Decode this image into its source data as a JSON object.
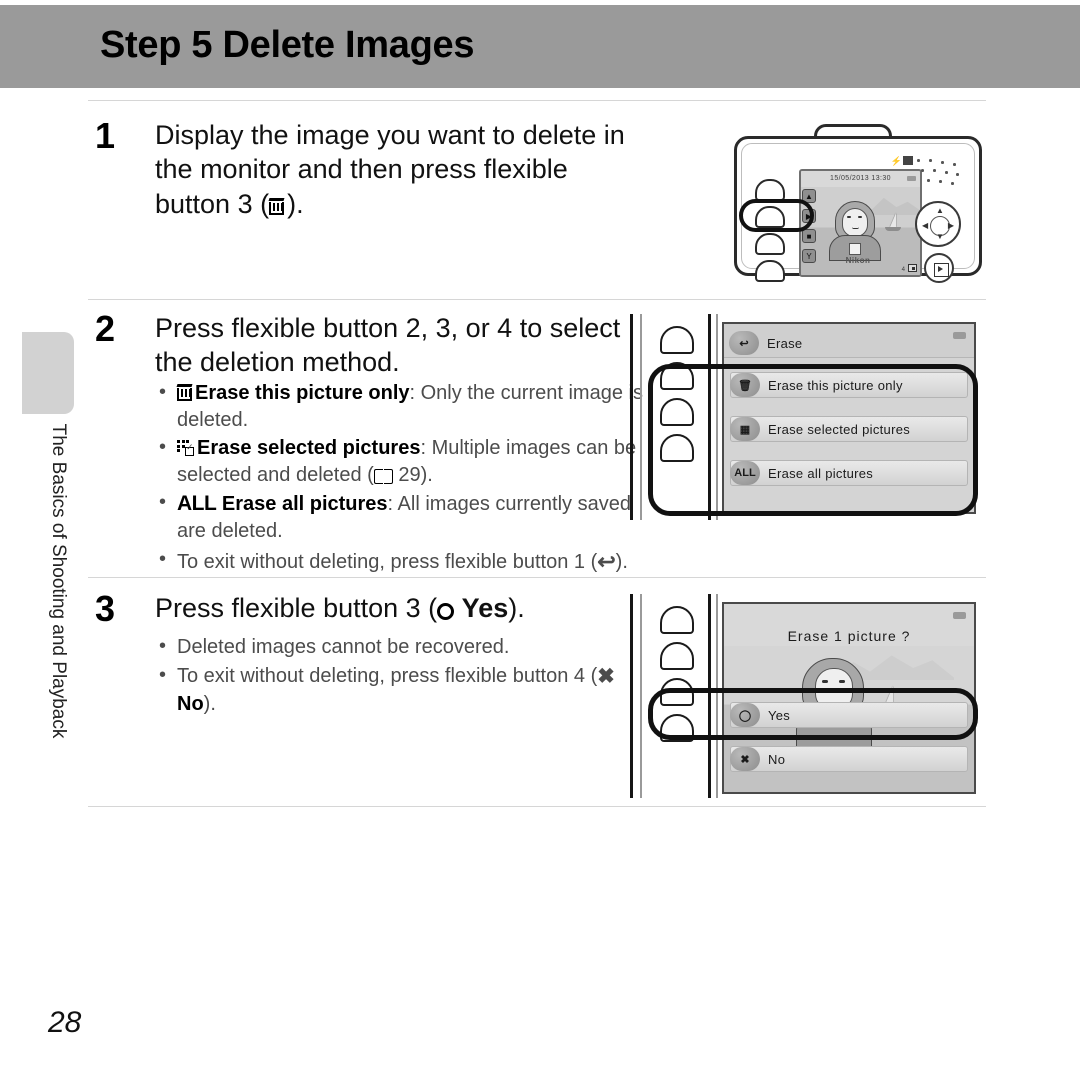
{
  "header": {
    "title": "Step 5 Delete Images"
  },
  "side_tab": {
    "label": "The Basics of Shooting and Playback"
  },
  "page_number": "28",
  "steps": [
    {
      "number": "1",
      "heading_line1": "Display the image you want to delete in the",
      "heading_line2_before": "monitor and then press flexible button 3 (",
      "heading_line2_after": ")."
    },
    {
      "number": "2",
      "heading_line1": "Press flexible button 2, 3, or 4 to select",
      "heading_line2": "the deletion method.",
      "bullets": [
        {
          "icon": "trash-icon",
          "term": "Erase this picture only",
          "text": ": Only the current image is deleted."
        },
        {
          "icon": "grid-check-icon",
          "term": "Erase selected pictures",
          "text_before": ": Multiple images can be selected and deleted (",
          "page_ref": "29",
          "text_after": ")."
        },
        {
          "icon": "all-icon",
          "icon_text": "ALL",
          "term": "Erase all pictures",
          "text": ": All images currently saved are deleted."
        },
        {
          "icon": "none",
          "text_before": "To exit without deleting, press flexible button 1 (",
          "text_after": ")."
        }
      ]
    },
    {
      "number": "3",
      "heading_before": "Press flexible button 3 (",
      "heading_yes": "Yes",
      "heading_after": ").",
      "bullets": [
        {
          "text": "Deleted images cannot be recovered."
        },
        {
          "text_before": "To exit without deleting, press flexible button 4 (",
          "no_label": "No",
          "text_after": ")."
        }
      ]
    }
  ],
  "camera_illustration": {
    "monitor_datetime": "15/05/2013  13:30",
    "monitor_frame_info": "4",
    "brand": "Nikon",
    "side_icons": [
      "upload-icon",
      "playback-icon",
      "trash-icon",
      "setup-icon"
    ],
    "highlighted_button": "flexible-button-3"
  },
  "erase_menu_screen": {
    "title": "Erase",
    "title_icon": "back-arrow-icon",
    "items": [
      {
        "badge": "trash-icon",
        "badge_text": "",
        "label": "Erase this picture only"
      },
      {
        "badge": "grid-check-icon",
        "badge_text": "",
        "label": "Erase selected pictures"
      },
      {
        "badge": "all-icon",
        "badge_text": "ALL",
        "label": "Erase all pictures"
      }
    ],
    "highlight": "buttons-2-3-4"
  },
  "confirm_dialog_screen": {
    "title": "Erase 1 picture ?",
    "options": [
      {
        "badge": "circle-icon",
        "label": "Yes",
        "highlighted": true
      },
      {
        "badge": "x-icon",
        "label": "No",
        "highlighted": false
      }
    ]
  },
  "colors": {
    "header_band": "#9a9a9a",
    "side_tab": "#d2d2d2",
    "rule": "#d6d6d6",
    "body_text": "#4c4c4c",
    "heading_text": "#111111"
  }
}
